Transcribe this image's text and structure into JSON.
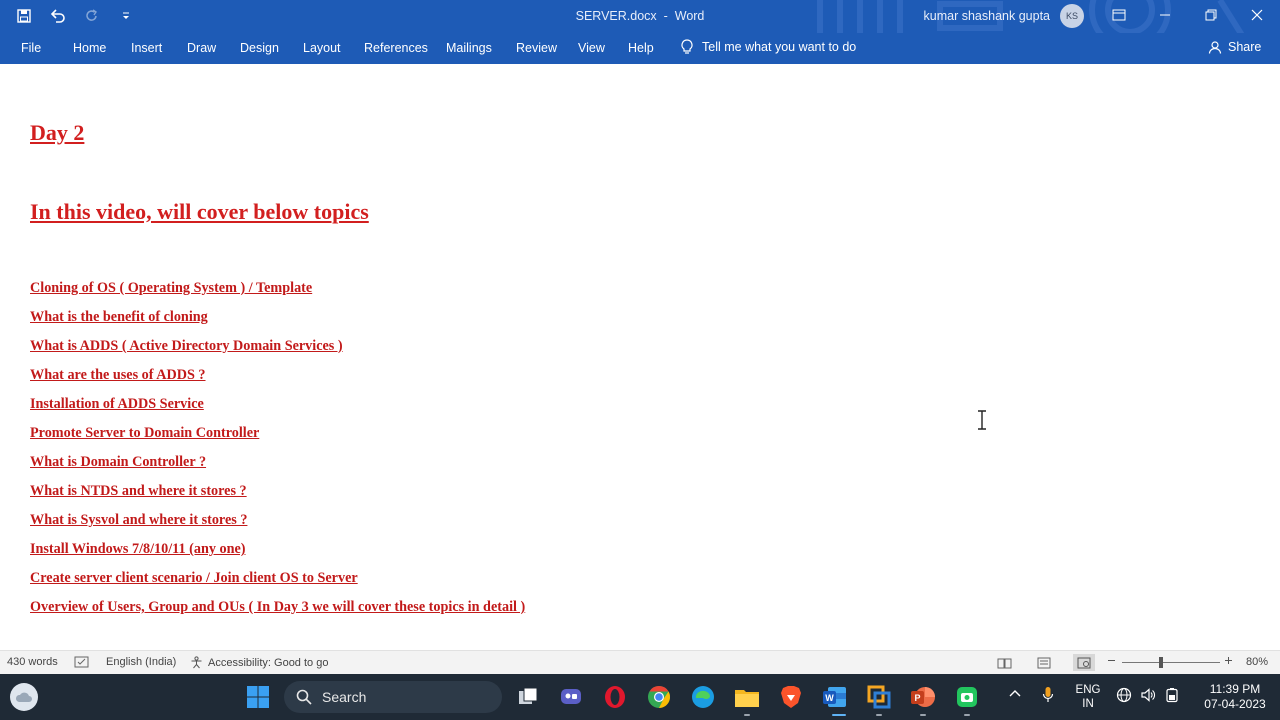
{
  "titlebar": {
    "document_name": "SERVER.docx",
    "separator": "-",
    "app_name": "Word",
    "user_name": "kumar shashank gupta",
    "user_initials": "KS"
  },
  "menu": {
    "items": [
      "File",
      "Home",
      "Insert",
      "Draw",
      "Design",
      "Layout",
      "References",
      "Mailings",
      "Review",
      "View",
      "Help"
    ],
    "tell_me": "Tell me what you want to do",
    "share": "Share"
  },
  "document": {
    "heading1": "Day 2",
    "heading2": "In this video, will cover below topics",
    "topics": [
      "Cloning of OS ( Operating System ) / Template",
      "What is the benefit of cloning",
      "What is ADDS ( Active Directory Domain Services )",
      "What are the uses of ADDS ?",
      "Installation of ADDS Service",
      "Promote Server to Domain Controller",
      "What is Domain Controller ?",
      "What is NTDS and where it stores ?",
      "What is Sysvol and where it stores ?",
      "Install Windows 7/8/10/11 (any one)",
      "Create server client scenario / Join client OS to Server",
      "Overview of Users, Group and OUs ( In Day 3 we will cover these topics in detail )"
    ]
  },
  "statusbar": {
    "word_count": "430 words",
    "language": "English (India)",
    "accessibility": "Accessibility: Good to go",
    "zoom": "80%",
    "zoom_fraction": 0.4
  },
  "taskbar": {
    "search_label": "Search",
    "lang_top": "ENG",
    "lang_bottom": "IN",
    "time": "11:39 PM",
    "date": "07-04-2023"
  },
  "colors": {
    "ribbon": "#1e5bb6",
    "heading_red": "#d21f1f",
    "taskbar": "#1f2a36"
  }
}
